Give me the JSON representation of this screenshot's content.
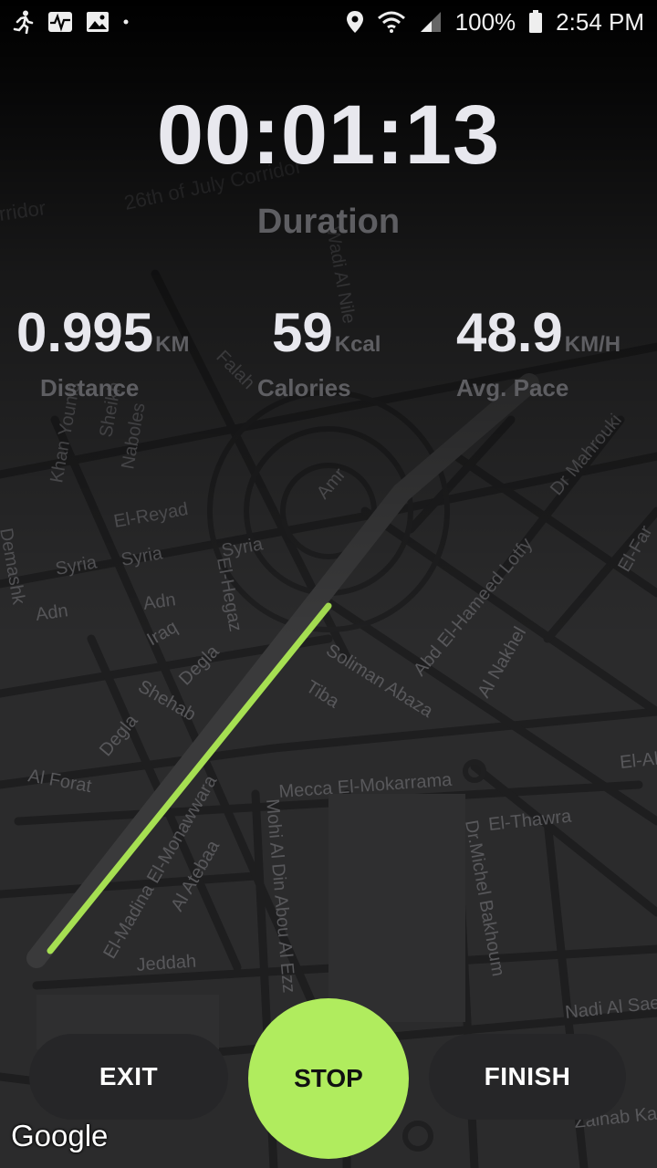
{
  "status_bar": {
    "icons_left": [
      "running-icon",
      "activity-icon",
      "image-icon",
      "dot-icon"
    ],
    "battery": "100%",
    "time": "2:54 PM"
  },
  "workout": {
    "duration_value": "00:01:13",
    "duration_label": "Duration",
    "distance_value": "0.995",
    "distance_unit": "KM",
    "distance_label": "Distance",
    "calories_value": "59",
    "calories_unit": "Kcal",
    "calories_label": "Calories",
    "pace_value": "48.9",
    "pace_unit": "KM/H",
    "pace_label": "Avg. Pace"
  },
  "buttons": {
    "exit": "EXIT",
    "stop": "STOP",
    "finish": "FINISH"
  },
  "map": {
    "attribution": "Google",
    "route_color": "#a6e052",
    "street_labels": [
      "26th of July Corridor",
      "rridor",
      "Wadi Al Nile",
      "Falah",
      "Khan Younis",
      "Sheikh",
      "Naboles",
      "El-Reyad",
      "Syria",
      "Syria",
      "Syria",
      "El-Hegaz",
      "Adn",
      "Adn",
      "Demashk",
      "Iraq",
      "Degla",
      "Shehab",
      "Degla",
      "Al Forat",
      "Amr",
      "Abd El-Hameed Lotfy",
      "Dr Mahrouki",
      "Al Nakhel",
      "Soliman Abaza",
      "Tiba",
      "Mecca El-Mokarrama",
      "El-Thawra",
      "Dr.Michel Bakhoum",
      "El-Madina El-Monawwara",
      "Al Atebaa",
      "Mohi Al Din Abou Al Ezz",
      "Jeddah",
      "Nadi Al Sae",
      "Zainab Ka",
      "El-Al",
      "El-Far"
    ]
  }
}
